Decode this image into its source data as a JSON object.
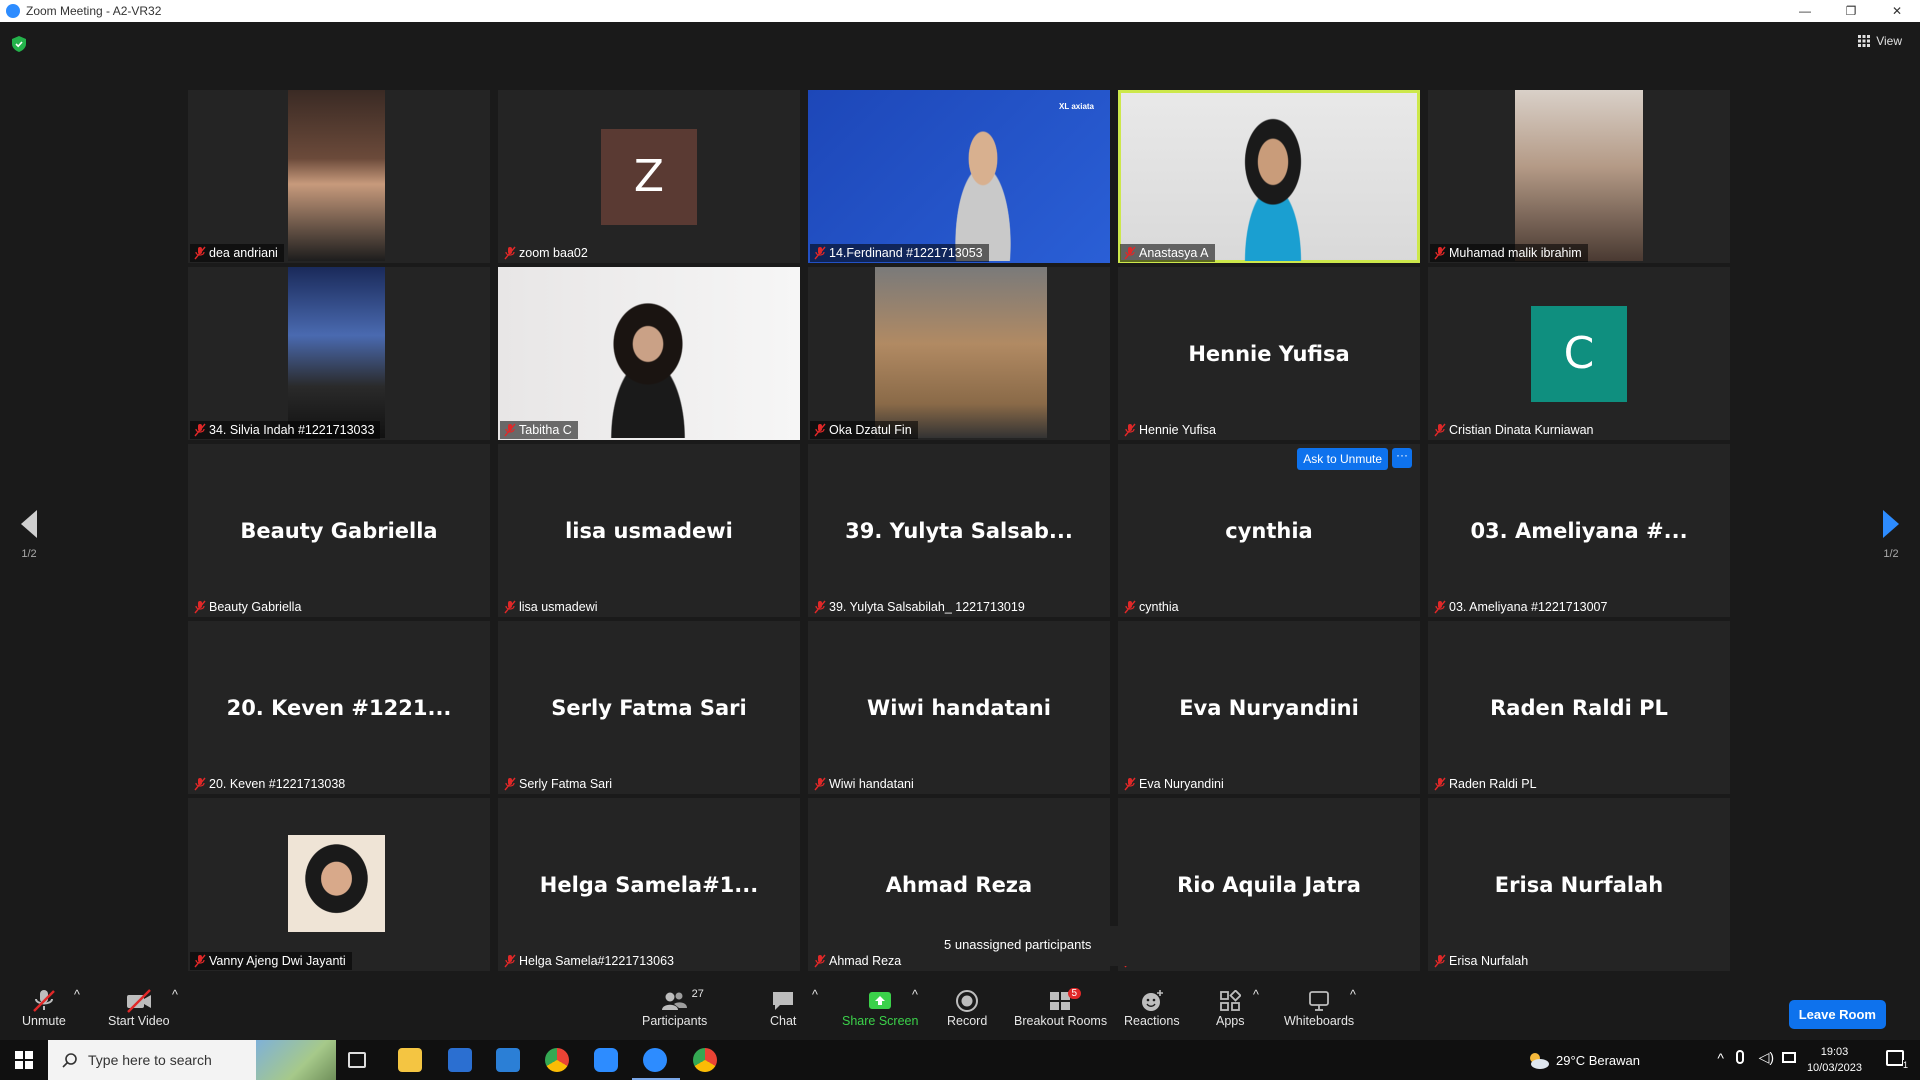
{
  "window": {
    "title": "Zoom Meeting - A2-VR32",
    "controls": [
      "—",
      "❐",
      "✕"
    ]
  },
  "topbar": {
    "view_label": "View"
  },
  "pager": {
    "left": "1/2",
    "right": "1/2"
  },
  "tiles": [
    {
      "label": "dea andriani",
      "kind": "video"
    },
    {
      "label": "zoom baa02",
      "kind": "avatar",
      "initial": "Z",
      "avatar_color": "#5a3a33"
    },
    {
      "label": "14.Ferdinand #1221713053",
      "kind": "video",
      "logo": "XL axiata"
    },
    {
      "label": "Anastasya A",
      "kind": "video",
      "active": true
    },
    {
      "label": "Muhamad malik ibrahim",
      "kind": "video"
    },
    {
      "label": "34. Silvia Indah #1221713033",
      "kind": "video"
    },
    {
      "label": "Tabitha C",
      "kind": "video"
    },
    {
      "label": "Oka Dzatul Fin",
      "kind": "video"
    },
    {
      "label": "Hennie Yufisa",
      "kind": "name",
      "bigname": "Hennie Yufisa"
    },
    {
      "label": "Cristian Dinata Kurniawan",
      "kind": "avatar",
      "initial": "C",
      "avatar_color": "#0f8f7f"
    },
    {
      "label": "Beauty Gabriella",
      "kind": "name",
      "bigname": "Beauty Gabriella"
    },
    {
      "label": "lisa usmadewi",
      "kind": "name",
      "bigname": "lisa usmadewi"
    },
    {
      "label": "39. Yulyta Salsabilah_ 1221713019",
      "kind": "name",
      "bigname": "39. Yulyta Salsab..."
    },
    {
      "label": "cynthia",
      "kind": "name",
      "bigname": "cynthia",
      "ask_unmute": "Ask to Unmute",
      "more": "···"
    },
    {
      "label": "03. Ameliyana #1221713007",
      "kind": "name",
      "bigname": "03. Ameliyana #..."
    },
    {
      "label": "20. Keven #1221713038",
      "kind": "name",
      "bigname": "20. Keven #1221..."
    },
    {
      "label": "Serly Fatma Sari",
      "kind": "name",
      "bigname": "Serly Fatma Sari"
    },
    {
      "label": "Wiwi handatani",
      "kind": "name",
      "bigname": "Wiwi handatani"
    },
    {
      "label": "Eva Nuryandini",
      "kind": "name",
      "bigname": "Eva Nuryandini"
    },
    {
      "label": "Raden Raldi PL",
      "kind": "name",
      "bigname": "Raden Raldi PL"
    },
    {
      "label": "Vanny Ajeng Dwi Jayanti",
      "kind": "video"
    },
    {
      "label": "Helga Samela#1221713063",
      "kind": "name",
      "bigname": "Helga  Samela#1..."
    },
    {
      "label": "Ahmad Reza",
      "kind": "name",
      "bigname": "Ahmad Reza"
    },
    {
      "label": "ila Jatra",
      "kind": "name",
      "bigname": "Rio Aquila Jatra"
    },
    {
      "label": "Erisa Nurfalah",
      "kind": "name",
      "bigname": "Erisa Nurfalah"
    }
  ],
  "tooltip": "5 unassigned participants",
  "toolbar": {
    "unmute": "Unmute",
    "start_video": "Start Video",
    "participants": "Participants",
    "participants_count": "27",
    "chat": "Chat",
    "share_screen": "Share Screen",
    "record": "Record",
    "breakout_rooms": "Breakout Rooms",
    "breakout_badge": "5",
    "reactions": "Reactions",
    "apps": "Apps",
    "whiteboards": "Whiteboards",
    "leave": "Leave Room",
    "caret": "^"
  },
  "taskbar": {
    "search_placeholder": "Type here to search",
    "weather": "29°C  Berawan",
    "time": "19:03",
    "date": "10/03/2023",
    "notification_count": "1"
  },
  "colors": {
    "accent": "#0e72ed",
    "active_speaker": "#cde84b",
    "share_green": "#3bd14a",
    "muted_red": "#e02828"
  }
}
